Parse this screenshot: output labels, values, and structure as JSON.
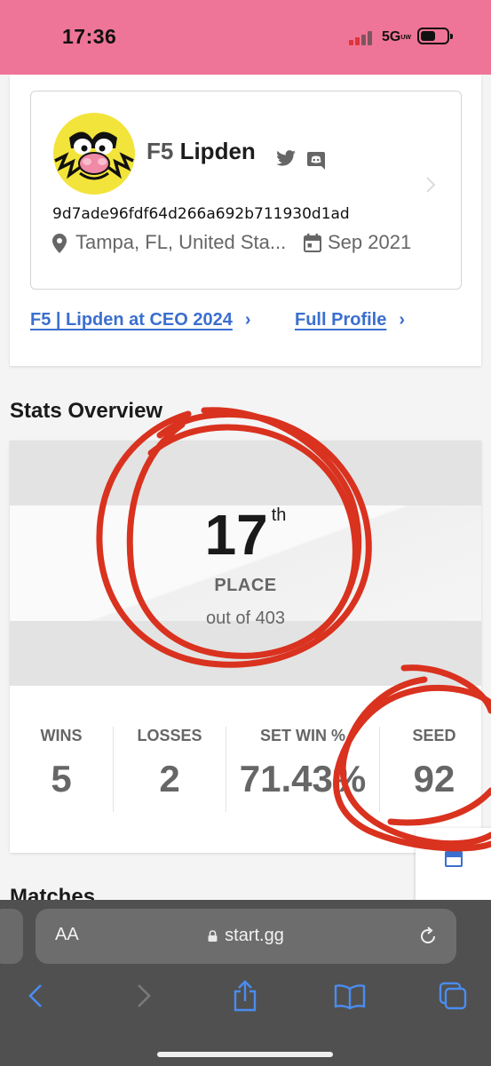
{
  "status_bar": {
    "time": "17:36",
    "network": "5G",
    "network_sub": "UW"
  },
  "profile": {
    "prefix": "F5",
    "gamer_tag": "Lipden",
    "player_id": "9d7ade96fdf64d266a692b711930d1ad",
    "location": "Tampa, FL, United Sta...",
    "joined": "Sep 2021",
    "links": {
      "event": "F5 | Lipden at CEO 2024",
      "full_profile": "Full Profile"
    }
  },
  "stats_overview": {
    "title": "Stats Overview",
    "placement": "17",
    "placement_suffix": "th",
    "place_label": "PLACE",
    "out_of": "out of 403",
    "columns": [
      {
        "label": "WINS",
        "value": "5"
      },
      {
        "label": "LOSSES",
        "value": "2"
      },
      {
        "label": "SET WIN %",
        "value": "71.43%"
      },
      {
        "label": "SEED",
        "value": "92"
      }
    ]
  },
  "next_section": {
    "title": "Matches"
  },
  "browser": {
    "aa_label": "AA",
    "url": "start.gg"
  },
  "colors": {
    "status_bar_bg": "#ee7597",
    "link": "#3a6fcf",
    "annotation": "#d9321f",
    "signal_red": "#e0333a"
  },
  "icons": [
    "twitter-icon",
    "discord-icon",
    "location-pin-icon",
    "calendar-icon",
    "chevron-right-icon",
    "lock-icon",
    "reload-icon",
    "back-icon",
    "forward-icon",
    "share-icon",
    "bookmarks-icon",
    "tabs-icon"
  ]
}
